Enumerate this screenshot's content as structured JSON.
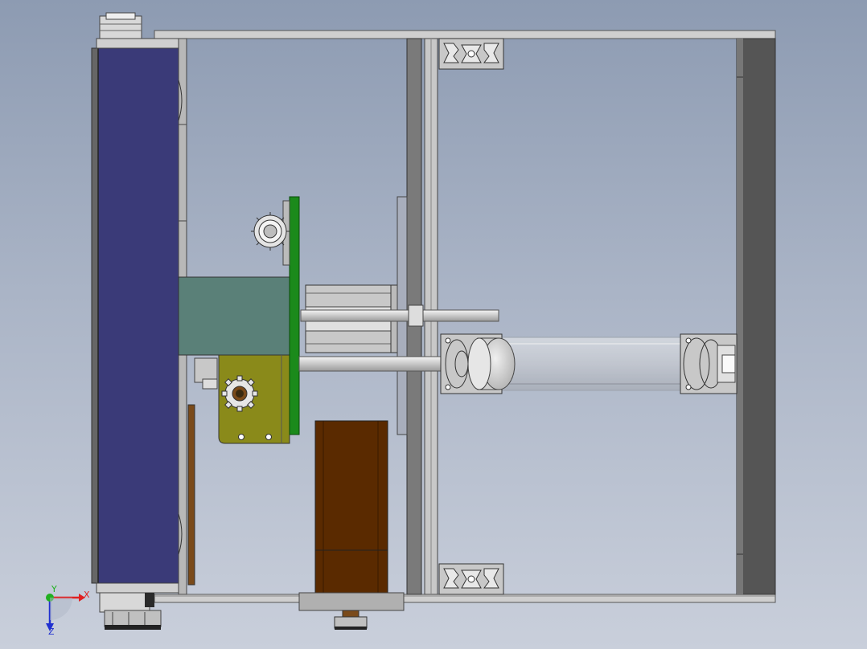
{
  "scene": {
    "type": "cad-assembly-view",
    "background_colors": [
      "#8d9bb2",
      "#c9cfdb"
    ]
  },
  "triad": {
    "x_label": "X",
    "y_label": "Y",
    "z_label": "Z",
    "colors": {
      "x": "#e02020",
      "y": "#20b020",
      "z": "#2030d0"
    }
  },
  "colors": {
    "frame": "#c8c8c8",
    "frame_edge": "#555555",
    "conveyor_belt": "#3a3a78",
    "housing_teal": "#5a8078",
    "pcb_green": "#1b8a1b",
    "olive_bracket": "#8a8a1a",
    "motor_brown": "#5a2a00",
    "dark_panel": "#555555",
    "shaft_silver": "#d6d6d6"
  }
}
